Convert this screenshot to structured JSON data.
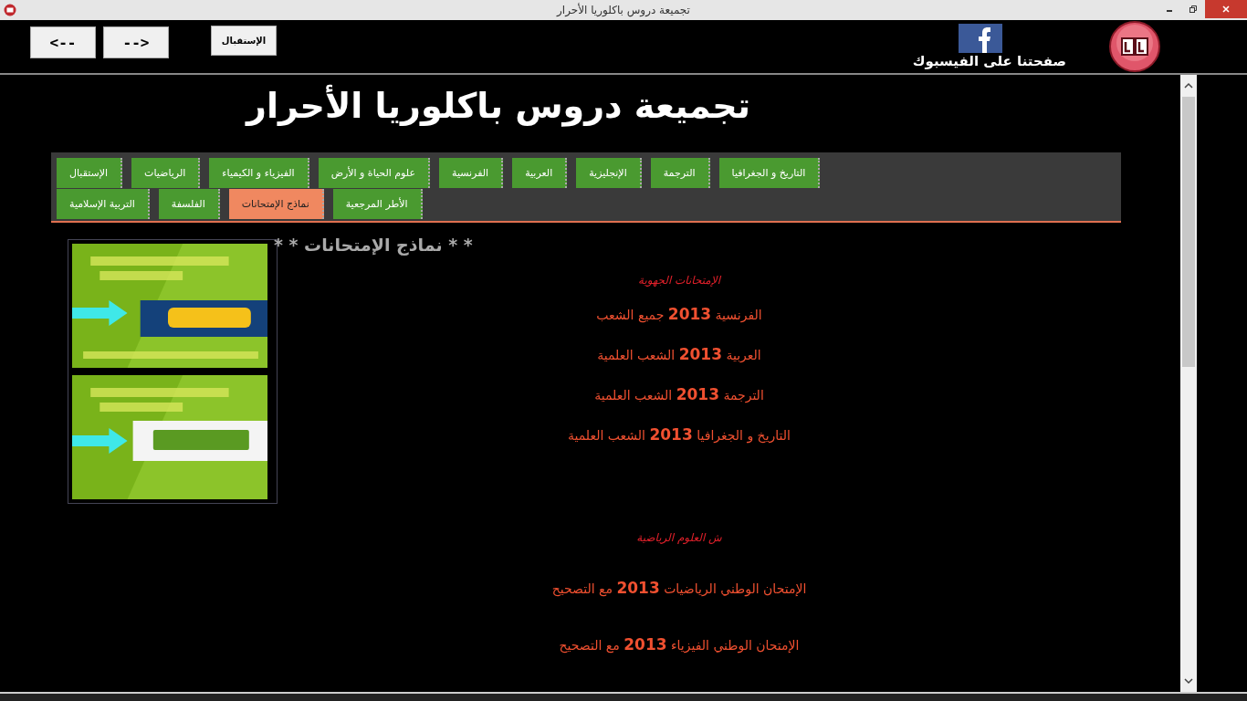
{
  "window": {
    "title": "تجميعة دروس باكلوريا الأحرار"
  },
  "toolbar": {
    "buttons": [
      {
        "label": "الإستقبال"
      },
      {
        "label": "-->"
      },
      {
        "label": "<--"
      }
    ],
    "facebook_label": "صفحتنا على الفيسبوك"
  },
  "page": {
    "title": "تجميعة دروس باكلوريا الأحرار",
    "tab_rows": [
      [
        {
          "label": "التاريخ و الجغرافيا",
          "selected": false
        },
        {
          "label": "الترجمة",
          "selected": false
        },
        {
          "label": "الإنجليزية",
          "selected": false
        },
        {
          "label": "العربية",
          "selected": false
        },
        {
          "label": "الفرنسية",
          "selected": false
        },
        {
          "label": "علوم الحياة و الأرض",
          "selected": false
        },
        {
          "label": "الفيزياء و الكيمياء",
          "selected": false
        },
        {
          "label": "الرياضيات",
          "selected": false
        },
        {
          "label": "الإستقبال",
          "selected": false
        }
      ],
      [
        {
          "label": "الأطر المرجعية",
          "selected": false
        },
        {
          "label": "نماذج الإمتحانات",
          "selected": true
        },
        {
          "label": "الفلسفة",
          "selected": false
        },
        {
          "label": "التربية الإسلامية",
          "selected": false
        }
      ]
    ],
    "section_title": "* * نماذج الإمتحانات * *",
    "items": [
      {
        "kind": "heading",
        "text": "الإمتحانات الجهوية"
      },
      {
        "kind": "link",
        "text": "الفرنسية **2013** جميع الشعب"
      },
      {
        "kind": "link",
        "text": "العربية **2013** الشعب العلمية"
      },
      {
        "kind": "link",
        "text": "الترجمة **2013** الشعب العلمية"
      },
      {
        "kind": "link",
        "text": "التاريخ و الجغرافيا **2013** الشعب العلمية"
      },
      {
        "kind": "heading",
        "text": "ش العلوم الرياضية"
      },
      {
        "kind": "link",
        "text": "الإمتحان الوطني الرياضيات **2013** مع التصحيح"
      },
      {
        "kind": "link",
        "text": "الإمتحان الوطني الفيزياء **2013** مع التصحيح"
      }
    ]
  }
}
